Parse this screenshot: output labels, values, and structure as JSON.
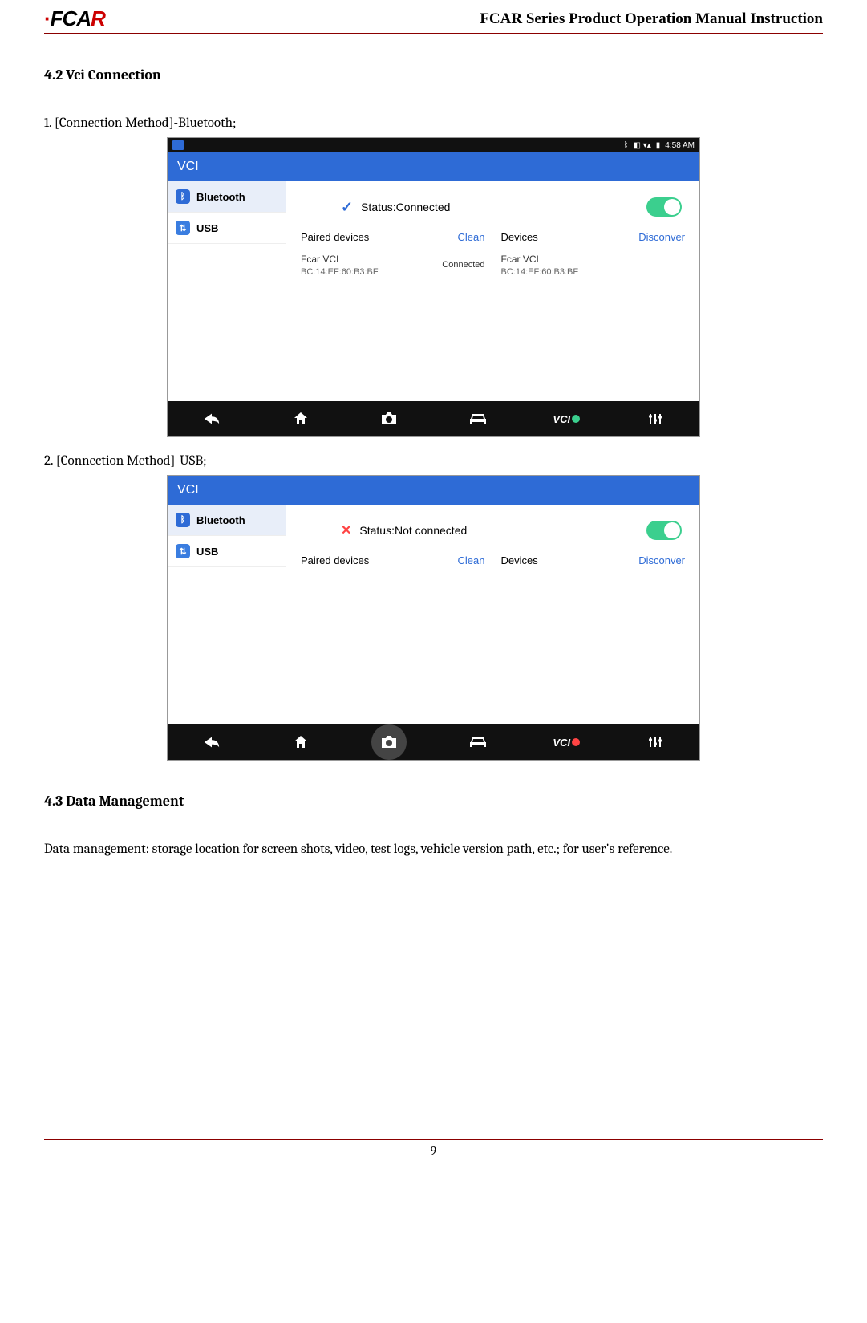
{
  "header": {
    "logo_text": "FCAR",
    "manual_title": "FCAR Series Product  Operation Manual Instruction"
  },
  "section42": {
    "heading": "4.2    Vci Connection",
    "step1": "1. [Connection Method]-Bluetooth;",
    "step2": "2. [Connection Method]-USB;"
  },
  "screenshot1": {
    "statusbar_time": "4:58 AM",
    "title": "VCI",
    "side_bluetooth": "Bluetooth",
    "side_usb": "USB",
    "status_text": "Status:Connected",
    "paired_label": "Paired devices",
    "clean": "Clean",
    "devices_label": "Devices",
    "disconver": "Disconver",
    "device_name": "Fcar VCI",
    "device_mac": "BC:14:EF:60:B3:BF",
    "connected": "Connected",
    "right_device_name": "Fcar VCI",
    "right_device_mac": "BC:14:EF:60:B3:BF",
    "vci_label": "VCI"
  },
  "screenshot2": {
    "title": "VCI",
    "side_bluetooth": "Bluetooth",
    "side_usb": "USB",
    "status_text": "Status:Not connected",
    "paired_label": "Paired devices",
    "clean": "Clean",
    "devices_label": "Devices",
    "disconver": "Disconver",
    "vci_label": "VCI"
  },
  "section43": {
    "heading": "4.3    Data Management",
    "body": "Data management: storage location for screen shots, video, test logs, vehicle version path, etc.; for user's reference."
  },
  "footer": {
    "page": "9"
  }
}
